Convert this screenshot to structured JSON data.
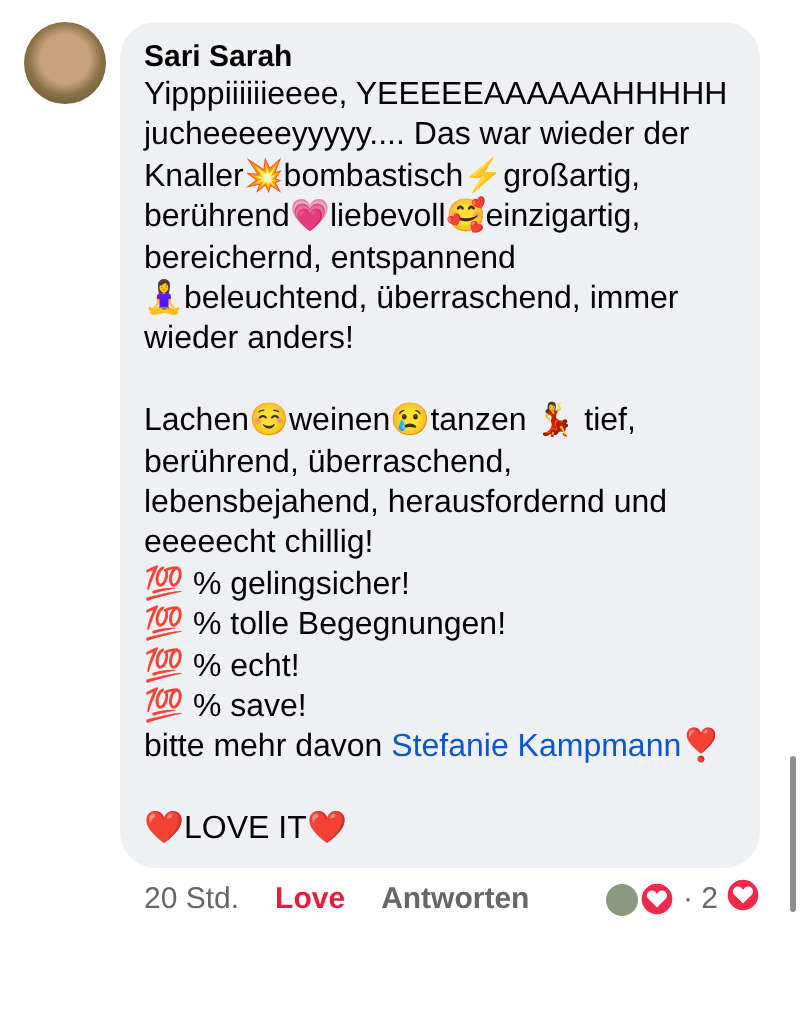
{
  "comment": {
    "author": "Sari Sarah",
    "paragraphs": [
      [
        {
          "text": "Yipppiiiiiieeee, YEEEEEAAAAAAHHHHH jucheeeeeyyyyy.... Das war wieder der Knaller💥bombastisch⚡️großartig, berührend💗liebevoll🥰einzigartig, bereichernd, entspannend 🧘‍♀️beleuchtend, überraschend, immer wieder anders!"
        }
      ],
      [
        {
          "text": "Lachen☺️weinen😢tanzen 💃 tief, berührend, überraschend, lebensbejahend, herausfordernd und eeeeecht chillig!"
        },
        {
          "text": "💯 % gelingsicher!"
        },
        {
          "text": "💯 % tolle Begegnungen!"
        },
        {
          "text": "💯 % echt!"
        },
        {
          "text": "💯 % save!"
        },
        {
          "text": "bitte mehr davon",
          "link": "Stefanie Kampmann",
          "after": "❣️"
        }
      ],
      [
        {
          "text": "❤️LOVE IT❤️"
        }
      ]
    ],
    "time": "20 Std.",
    "reaction_label": "Love",
    "reacted": true,
    "reply_label": "Antworten",
    "reaction_count": "· 2"
  }
}
